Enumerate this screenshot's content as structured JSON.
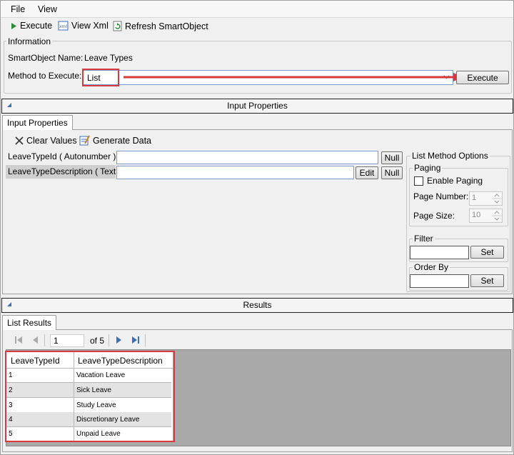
{
  "menu": {
    "file": "File",
    "view": "View"
  },
  "toolbar": {
    "execute": "Execute",
    "view_xml": "View Xml",
    "refresh": "Refresh SmartObject"
  },
  "info": {
    "group_title": "Information",
    "smartobject_label": "SmartObject Name:",
    "smartobject_value": "Leave Types",
    "method_label": "Method to Execute:",
    "method_value": "List",
    "execute_button": "Execute"
  },
  "input_section": {
    "title": "Input Properties",
    "tab": "Input Properties",
    "clear_values": "Clear Values",
    "generate_data": "Generate Data",
    "properties": [
      {
        "label": "LeaveTypeId ( Autonumber )",
        "value": "",
        "null_button": "Null"
      },
      {
        "label": "LeaveTypeDescription ( Text )",
        "value": "",
        "edit_button": "Edit",
        "null_button": "Null"
      }
    ]
  },
  "list_options": {
    "title": "List Method Options",
    "paging_title": "Paging",
    "enable_paging": "Enable Paging",
    "page_number_label": "Page Number:",
    "page_number_value": "1",
    "page_size_label": "Page Size:",
    "page_size_value": "10",
    "filter_title": "Filter",
    "filter_set": "Set",
    "orderby_title": "Order By",
    "orderby_set": "Set"
  },
  "results_section": {
    "title": "Results",
    "tab": "List Results",
    "pager": {
      "current_page": "1",
      "of_label": "of 5"
    },
    "columns": [
      "LeaveTypeId",
      "LeaveTypeDescription"
    ],
    "rows": [
      [
        "1",
        "Vacation Leave"
      ],
      [
        "2",
        "Sick Leave"
      ],
      [
        "3",
        "Study Leave"
      ],
      [
        "4",
        "Discretionary Leave"
      ],
      [
        "5",
        "Unpaid Leave"
      ]
    ]
  },
  "colors": {
    "annotation_red": "#d9393e",
    "accent_blue": "#3a6fb5"
  }
}
